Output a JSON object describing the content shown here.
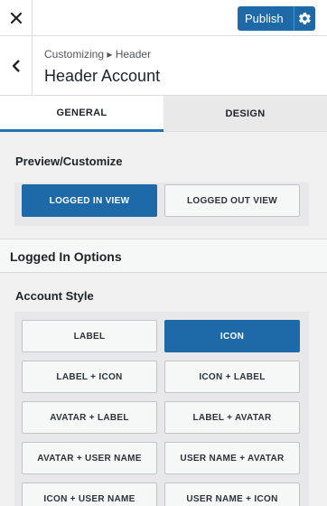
{
  "topbar": {
    "close_icon": "close-icon",
    "publish_label": "Publish",
    "publish_icon": "gear-icon"
  },
  "section": {
    "back_icon": "chevron-left-icon",
    "breadcrumb": "Customizing ▸ Header",
    "title": "Header Account"
  },
  "tabs": [
    {
      "label": "GENERAL",
      "active": true
    },
    {
      "label": "DESIGN",
      "active": false
    }
  ],
  "preview": {
    "title": "Preview/Customize",
    "options": [
      "LOGGED IN VIEW",
      "LOGGED OUT VIEW"
    ],
    "selected": "LOGGED IN VIEW"
  },
  "logged_in": {
    "title": "Logged In Options"
  },
  "account_style": {
    "title": "Account Style",
    "options": [
      "LABEL",
      "ICON",
      "LABEL + ICON",
      "ICON + LABEL",
      "AVATAR + LABEL",
      "LABEL + AVATAR",
      "AVATAR + USER NAME",
      "USER NAME + AVATAR",
      "ICON + USER NAME",
      "USER NAME + ICON"
    ],
    "selected": "ICON"
  },
  "colors": {
    "accent": "#1e6aa8"
  }
}
